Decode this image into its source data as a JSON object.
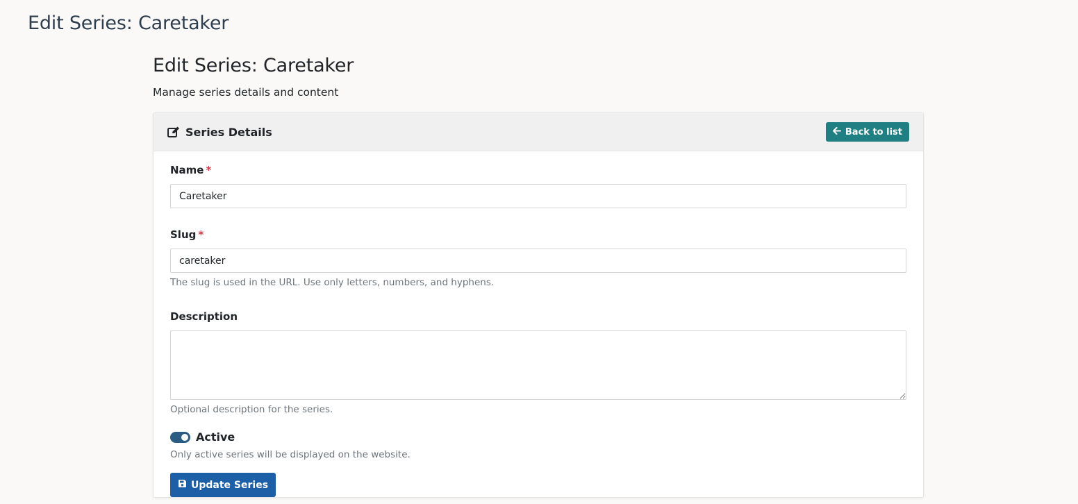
{
  "page": {
    "header_title": "Edit Series: Caretaker",
    "title": "Edit Series: Caretaker",
    "subtitle": "Manage series details and content"
  },
  "card": {
    "title": "Series Details",
    "title_icon": "edit-icon",
    "back_button_label": "Back to list",
    "back_button_icon": "arrow-left-icon"
  },
  "form": {
    "name": {
      "label": "Name",
      "required_mark": "*",
      "value": "Caretaker"
    },
    "slug": {
      "label": "Slug",
      "required_mark": "*",
      "value": "caretaker",
      "help": "The slug is used in the URL. Use only letters, numbers, and hyphens."
    },
    "description": {
      "label": "Description",
      "value": "",
      "help": "Optional description for the series."
    },
    "active": {
      "label": "Active",
      "checked": true,
      "help": "Only active series will be displayed on the website."
    },
    "submit_label": "Update Series",
    "submit_icon": "save-icon"
  },
  "colors": {
    "back_button": "#1f7f83",
    "submit_button": "#1d5fa6",
    "switch_on": "#2b5c82",
    "required": "#dc3545"
  }
}
